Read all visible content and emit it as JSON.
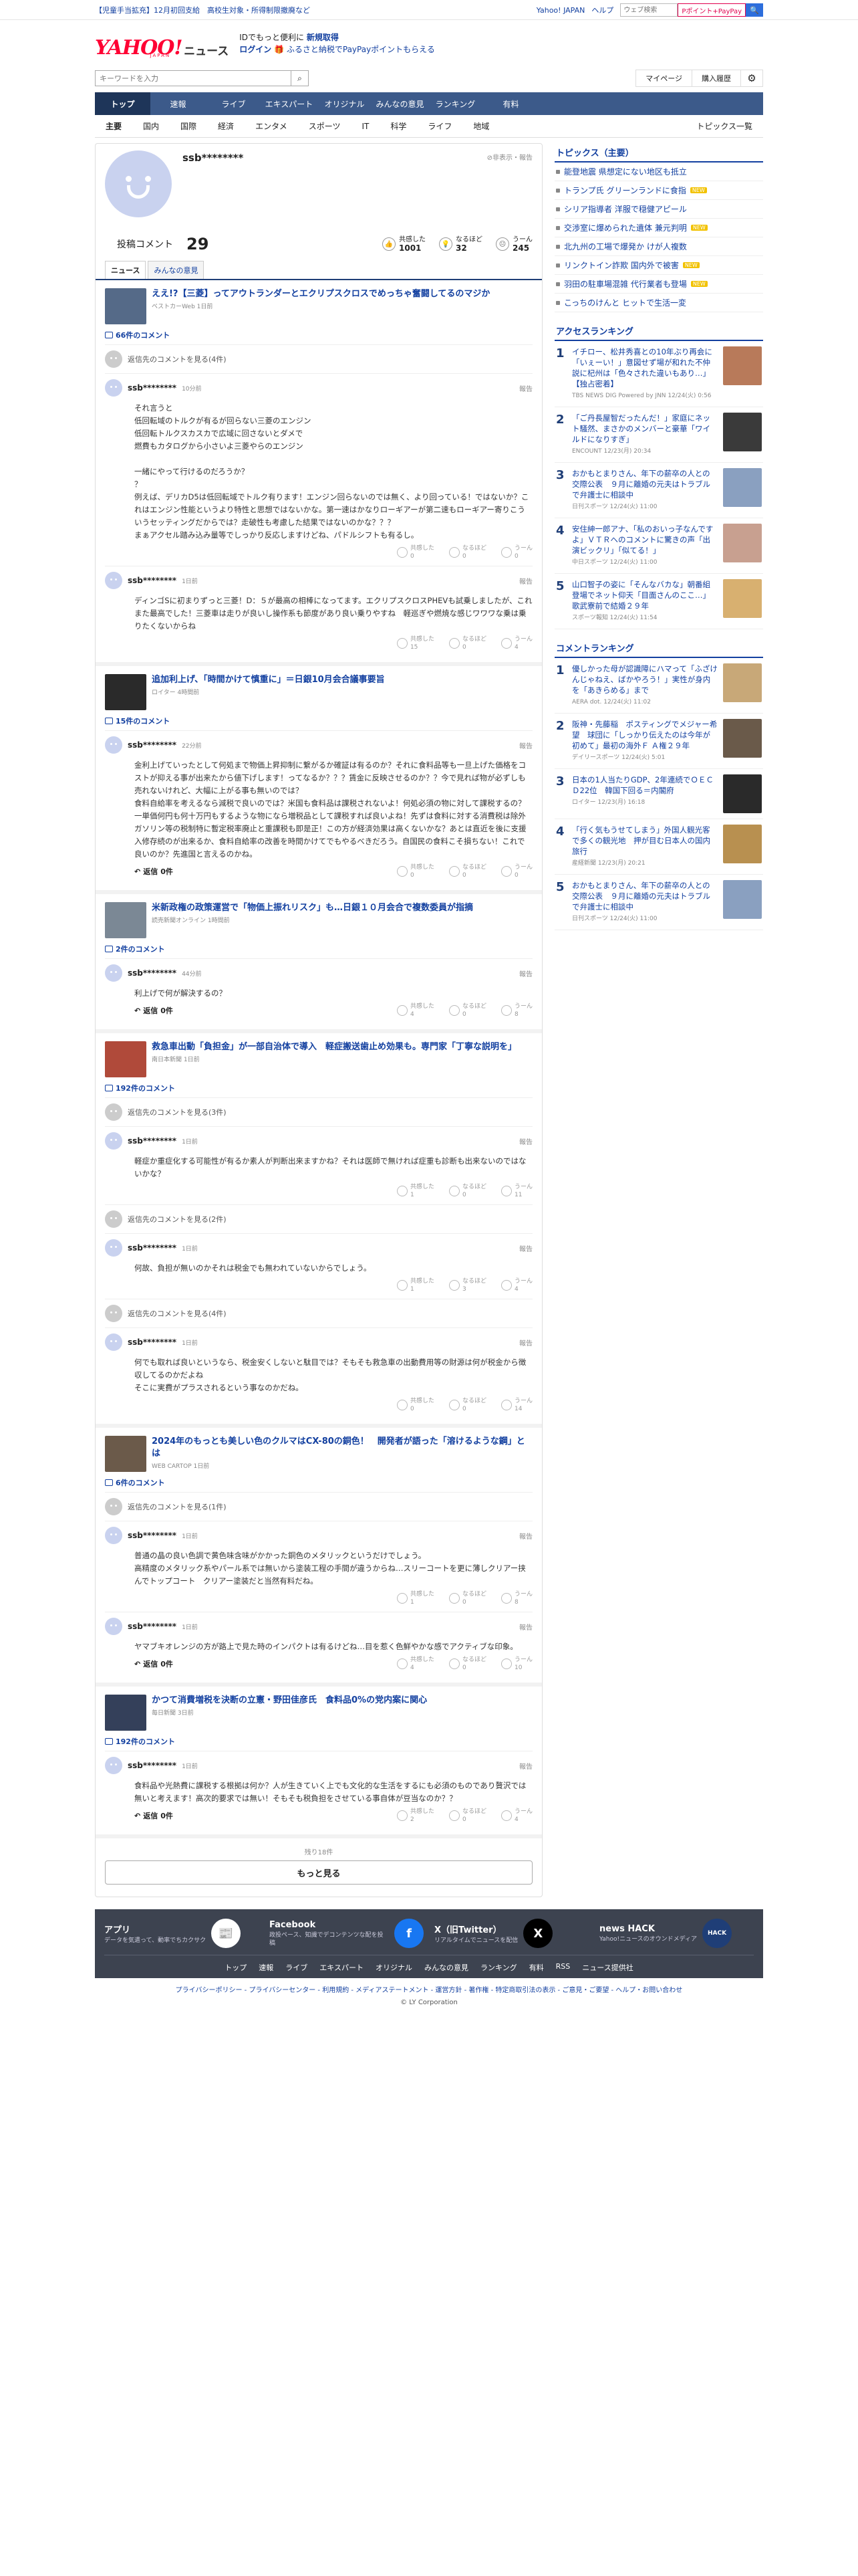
{
  "topbar": {
    "promo": "【児童手当拡充】12月初回支給　高校生対象・所得制限撤廃など",
    "links": [
      "Yahoo! JAPAN",
      "ヘルプ"
    ],
    "search_placeholder": "ウェブ検索",
    "paypay": "Pポイント+PayPay",
    "search_btn": "🔍"
  },
  "header": {
    "logo": "YAHOO!",
    "logo_sub": "JAPAN",
    "logo_news": "ニュース",
    "tag_line1_pre": "IDでもっと便利に",
    "tag_line1_link": "新規取得",
    "tag_line2_login": "ログイン",
    "tag_line2_text": "ふるさと納税でPayPayポイントもらえる"
  },
  "search": {
    "placeholder": "キーワードを入力",
    "mypage": "マイページ",
    "history": "購入履歴"
  },
  "nav": [
    "トップ",
    "速報",
    "ライブ",
    "エキスパート",
    "オリジナル",
    "みんなの意見",
    "ランキング",
    "有料"
  ],
  "subnav": [
    "主要",
    "国内",
    "国際",
    "経済",
    "エンタメ",
    "スポーツ",
    "IT",
    "科学",
    "ライフ",
    "地域"
  ],
  "subnav_right": "トピックス一覧",
  "profile": {
    "name": "ssb********",
    "nonpub": "非表示・報告",
    "comments_label": "投稿コメント",
    "comments_count": "29",
    "reactions": [
      {
        "label": "共感した",
        "value": "1001"
      },
      {
        "label": "なるほど",
        "value": "32"
      },
      {
        "label": "うーん",
        "value": "245"
      }
    ],
    "tabs": [
      "ニュース",
      "みんなの意見"
    ]
  },
  "articles": [
    {
      "title": "ええ!?【三菱】ってアウトランダーとエクリプスクロスでめっちゃ奮闘してるのマジか",
      "source": "ベストカーWeb 1日前",
      "thumb": "#556a88",
      "count": "66件のコメント",
      "items": [
        {
          "type": "reply",
          "text": "返信先のコメントを見る(4件)"
        },
        {
          "type": "comment",
          "name": "ssb********",
          "time": "10分前",
          "body": "それ言うと\n低回転域のトルクが有るが回らない三菱のエンジン\n低回転トルクスカスカで広域に回さないとダメで\n燃費もカタログから小さいよ三菱やらのエンジン\n\n一緒にやって行けるのだろうか？\n？\n例えば、デリカD5は低回転域でトルク有ります！エンジン回らないのでは無く、より回っている！ではないか？これはエンジン性能というより特性と思想ではないかな。第一速はかなりローギアーが第二速もローギアー寄りこういうセッティングだからでは？走破性も考慮した結果ではないのかな？？？\nまぁアクセル踏み込み量等でしっかり反応しますけどね、パドルシフトも有るし。",
          "r": [
            "0",
            "0",
            "0"
          ],
          "showreply": false
        },
        {
          "type": "comment",
          "name": "ssb********",
          "time": "1日前",
          "body": "ディンゴSに初まりずっと三菱！D：５が最高の相棒になってます。エクリプスクロスPHEVも試乗しましたが、これまた最高でした！三菱車は走りが良いし操作系も節度があり良い乗りやすね　軽巡ぎや燃焼な感じワワワな乗は乗りたくないからね",
          "r": [
            "15",
            "0",
            "4"
          ],
          "showreply": false
        }
      ]
    },
    {
      "title": "追加利上げ、「時間かけて慎重に」＝日銀10月会合議事要旨",
      "source": "ロイター 4時間前",
      "thumb": "#2a2a2a",
      "count": "15件のコメント",
      "items": [
        {
          "type": "comment",
          "name": "ssb********",
          "time": "22分前",
          "body": "金利上げていったとして何処まで物価上昇抑制に繋がるか確証は有るのか？それに食料品等も一旦上げた価格をコストが抑える事が出来たから値下げします！ってなるか？？？賃金に反映させるのか？？今で見れば物が必ずしも売れないけれど、大幅に上がる事も無いのでは？\n食料自給率を考えるなら減税で良いのでは？米国も食料品は課税されないよ！何処必須の物に対して課税するの？一単価何円も何十万円もするような物になら増税品として課税すれば良いよね！先ずは食料に対する消費税は除外\nガソリン等の税制特に暫定税率廃止と重課税も即是正！この方が経済効果は高くないかな？あとは直近を後に支援入修存続のが出来るか、食料自給率の改善を時間かけてでもやるべきだろう。自国民の食料こそ損ちない！これで良いのか？先進国と言えるのかね。",
          "r": [
            "0",
            "0",
            "0"
          ],
          "showreply": true
        }
      ]
    },
    {
      "title": "米新政権の政策運営で「物価上振れリスク」も…日銀１０月会合で複数委員が指摘",
      "source": "読売新聞オンライン 1時間前",
      "thumb": "#7b8895",
      "count": "2件のコメント",
      "items": [
        {
          "type": "comment",
          "name": "ssb********",
          "time": "44分前",
          "body": "利上げで何が解決するの？",
          "r": [
            "4",
            "0",
            "8"
          ],
          "showreply": true
        }
      ]
    },
    {
      "title": "救急車出動「負担金」が一部自治体で導入　軽症搬送歯止め効果も。専門家「丁寧な説明を」",
      "source": "南日本新聞 1日前",
      "thumb": "#b04a3a",
      "count": "192件のコメント",
      "items": [
        {
          "type": "reply",
          "text": "返信先のコメントを見る(3件)"
        },
        {
          "type": "comment",
          "name": "ssb********",
          "time": "1日前",
          "body": "軽症か重症化する可能性が有るか素人が判断出来ますかね？それは医師で無ければ症重も診断も出来ないのではないかな？",
          "r": [
            "1",
            "0",
            "11"
          ],
          "showreply": false
        },
        {
          "type": "reply",
          "text": "返信先のコメントを見る(2件)"
        },
        {
          "type": "comment",
          "name": "ssb********",
          "time": "1日前",
          "body": "何故、負担が無いのかそれは税金でも無われていないからでしょう。",
          "r": [
            "1",
            "3",
            "4"
          ],
          "showreply": false
        },
        {
          "type": "reply",
          "text": "返信先のコメントを見る(4件)"
        },
        {
          "type": "comment",
          "name": "ssb********",
          "time": "1日前",
          "body": "何でも取れば良いというなら、税金安くしないと駄目では？そもそも救急車の出動費用等の財源は何が税金から徴収してるのかだよね\nそこに実費がプラスされるという事なのかだね。",
          "r": [
            "0",
            "0",
            "14"
          ],
          "showreply": false
        }
      ]
    },
    {
      "title": "2024年のもっとも美しい色のクルマはCX-80の銅色！　開発者が語った「溶けるような鋼」とは",
      "source": "WEB CARTOP 1日前",
      "thumb": "#6b5a4a",
      "count": "6件のコメント",
      "items": [
        {
          "type": "reply",
          "text": "返信先のコメントを見る(1件)"
        },
        {
          "type": "comment",
          "name": "ssb********",
          "time": "1日前",
          "body": "普通の晶の良い色調で黄色味含味がかかった銅色のメタリックというだけでしょう。\n高精度のメタリック系やパール系では無いから塗装工程の手間が違うからね…スリーコートを更に薄しクリアー挟んでトップコート　クリアー塗装だと当然有料だね。",
          "r": [
            "1",
            "0",
            "8"
          ],
          "showreply": false
        },
        {
          "type": "comment",
          "name": "ssb********",
          "time": "1日前",
          "body": "ヤマブキオレンジの方が路上で見た時のインパクトは有るけどね…目を惹く色鮮やかな感でアクティブな印象。",
          "r": [
            "4",
            "0",
            "10"
          ],
          "showreply": true
        }
      ]
    },
    {
      "title": "かつて消費増税を決断の立憲・野田佳彦氏　食料品0%の党内案に関心",
      "source": "毎日新聞 3日前",
      "thumb": "#34405a",
      "count": "192件のコメント",
      "items": [
        {
          "type": "comment",
          "name": "ssb********",
          "time": "1日前",
          "body": "食料品や光熱費に課税する根拠は何か？人が生きていく上でも文化的な生活をするにも必須のものであり贅沢では無いと考えます！高次的要求では無い！そもそも税負担をさせている事自体が豆当なのか？？",
          "r": [
            "2",
            "0",
            "4"
          ],
          "showreply": true
        }
      ]
    }
  ],
  "labels": {
    "report": "報告",
    "reply": "返信",
    "reply_count": "0件",
    "r_kyokan": "共感した",
    "r_naruhodo": "なるほど",
    "r_un": "うーん"
  },
  "more": {
    "remaining": "残り18件",
    "button": "もっと見る"
  },
  "side": {
    "topics_title": "トピックス（主要）",
    "topics": [
      {
        "t": "能登地震 県想定にない地区も抵立",
        "new": false
      },
      {
        "t": "トランプ氏 グリーンランドに食指",
        "new": true
      },
      {
        "t": "シリア指導者 洋服で穏健アピール",
        "new": false
      },
      {
        "t": "交渉室に爆められた遺体 兼元判明",
        "new": true
      },
      {
        "t": "北九州の工場で爆発か けが人複数",
        "new": false
      },
      {
        "t": "リンクトイン詐欺 国内外で被害",
        "new": true
      },
      {
        "t": "羽田の駐車場混雑 代行業者も登場",
        "new": true
      },
      {
        "t": "こっちのけんと ヒットで生活一変",
        "new": false
      }
    ],
    "access_title": "アクセスランキング",
    "access": [
      {
        "n": "1",
        "t": "イチロー、松井秀喜との10年ぶり再会に「いぇーい！」意図せず場が和れた不仲説に杞州は「色々された違いもあり…」【独占密着】",
        "s": "TBS NEWS DIG Powered by JNN 12/24(火) 0:56",
        "c": "#b87a5a"
      },
      {
        "n": "2",
        "t": "「ご丹長屋智だったんだ！」家庭にネット騒然、まさかのメンバーと豪華「ワイルドになりすぎ」",
        "s": "ENCOUNT 12/23(月) 20:34",
        "c": "#3a3a3a"
      },
      {
        "n": "3",
        "t": "おかもとまりさん、年下の薪卒の人との交際公表　９月に離婚の元夫はトラブルで弁護士に相談中",
        "s": "日刊スポーツ 12/24(火) 11:00",
        "c": "#8aa0c0"
      },
      {
        "n": "4",
        "t": "安住紳一郎アナ、「私のおいっ子なんですよ」ＶＴＲへのコメントに驚きの声「出演ビックリ」「似てる！」",
        "s": "中日スポーツ 12/24(火) 11:00",
        "c": "#c8a090"
      },
      {
        "n": "5",
        "t": "山口智子の姿に「そんなバカな」朝番組登場でネット仰天「目面さんのここ…」歌武寮前で結婚２９年",
        "s": "スポーツ報知 12/24(火) 11:54",
        "c": "#d8b070"
      }
    ],
    "comment_title": "コメントランキング",
    "comments": [
      {
        "n": "1",
        "t": "優しかった母が認識障にハマって「ふざけんじゃねえ、ばかやろう！」実性が身内を「あきらめる」まで",
        "s": "AERA dot. 12/24(火) 11:02",
        "c": "#c8a878"
      },
      {
        "n": "2",
        "t": "阪神・先藤稲　ポスティングでメジャー希望　球団に「しっかり伝えたのは今年が初めて」最初の海外Ｆ Ａ権２９年",
        "s": "デイリースポーツ 12/24(火) 5:01",
        "c": "#6a5a4a"
      },
      {
        "n": "3",
        "t": "日本の1人当たりGDP、2年連続でＯＥＣＤ22位　韓国下回る＝内閣府",
        "s": "ロイター 12/23(月) 16:18",
        "c": "#2a2a2a"
      },
      {
        "n": "4",
        "t": "「行く気もうせてしまう」外国人観光客で多くの観光地　押が目む日本人の国内旅行",
        "s": "産経新聞 12/23(月) 20:21",
        "c": "#b89050"
      },
      {
        "n": "5",
        "t": "おかもとまりさん、年下の薪卒の人との交際公表　９月に離婚の元夫はトラブルで弁護士に相談中",
        "s": "日刊スポーツ 12/24(火) 11:00",
        "c": "#8aa0c0"
      }
    ]
  },
  "footer": {
    "apps": [
      {
        "t": "アプリ",
        "d": "データを気遣って、動率でちカクサク",
        "icon": "📰",
        "bg": "#fff",
        "fg": "#1f3e77"
      },
      {
        "t": "Facebook",
        "d": "政投ペース、知識でデコンテンツな配を投稿",
        "icon": "f",
        "bg": "#1877f2",
        "fg": "#fff"
      },
      {
        "t": "X（旧Twitter）",
        "d": "リアルタイムでニュースを配信",
        "icon": "X",
        "bg": "#000",
        "fg": "#fff"
      },
      {
        "t": "news HACK",
        "d": "Yahoo!ニュースのオウンドメディア",
        "icon": "HACK",
        "bg": "#1f3e77",
        "fg": "#fff"
      }
    ],
    "links": [
      "トップ",
      "速報",
      "ライブ",
      "エキスパート",
      "オリジナル",
      "みんなの意見",
      "ランキング",
      "有料",
      "RSS",
      "ニュース提供社"
    ]
  },
  "bottom": {
    "links": "プライバシーポリシー - プライバシーセンター - 利用規約 - メディアステートメント - 運営方針 - 著作権 - 特定商取引法の表示 - ご意見・ご要望 - ヘルプ・お問い合わせ",
    "copy": "© LY Corporation"
  }
}
